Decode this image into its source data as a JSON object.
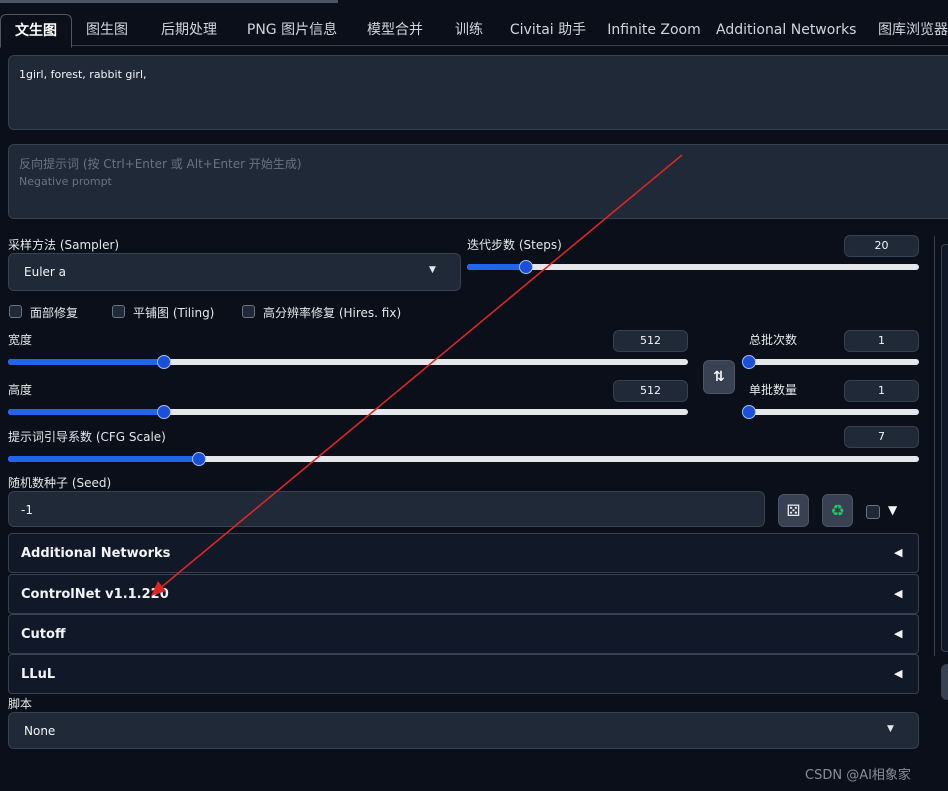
{
  "tabs": [
    "文生图",
    "图生图",
    "后期处理",
    "PNG 图片信息",
    "模型合并",
    "训练",
    "Civitai 助手",
    "Infinite Zoom",
    "Additional Networks",
    "图库浏览器"
  ],
  "prompt": {
    "value": "1girl, forest, rabbit girl,"
  },
  "negative_prompt": {
    "placeholder_line1": "反向提示词 (按 Ctrl+Enter 或 Alt+Enter 开始生成)",
    "placeholder_line2": "Negative prompt"
  },
  "sampler": {
    "label": "采样方法 (Sampler)",
    "value": "Euler a"
  },
  "steps": {
    "label": "迭代步数 (Steps)",
    "value": "20",
    "level": 0.13
  },
  "checkboxes": {
    "face_restore": "面部修复",
    "tiling": "平铺图 (Tiling)",
    "hires_fix": "高分辨率修复 (Hires. fix)"
  },
  "width": {
    "label": "宽度",
    "value": "512",
    "level": 0.23
  },
  "height": {
    "label": "高度",
    "value": "512",
    "level": 0.23
  },
  "batch_count": {
    "label": "总批次数",
    "value": "1",
    "level": 0.0
  },
  "batch_size": {
    "label": "单批数量",
    "value": "1",
    "level": 0.0
  },
  "cfg": {
    "label": "提示词引导系数 (CFG Scale)",
    "value": "7",
    "level": 0.21
  },
  "seed": {
    "label": "随机数种子 (Seed)",
    "value": "-1"
  },
  "accordions": [
    "Additional Networks",
    "ControlNet v1.1.220",
    "Cutoff",
    "LLuL"
  ],
  "script": {
    "label": "脚本",
    "value": "None"
  },
  "watermark": "CSDN @AI相象家",
  "colors": {
    "background": "#0b0f19",
    "accent": "#2563eb",
    "annotation_arrow": "#dc2626"
  }
}
